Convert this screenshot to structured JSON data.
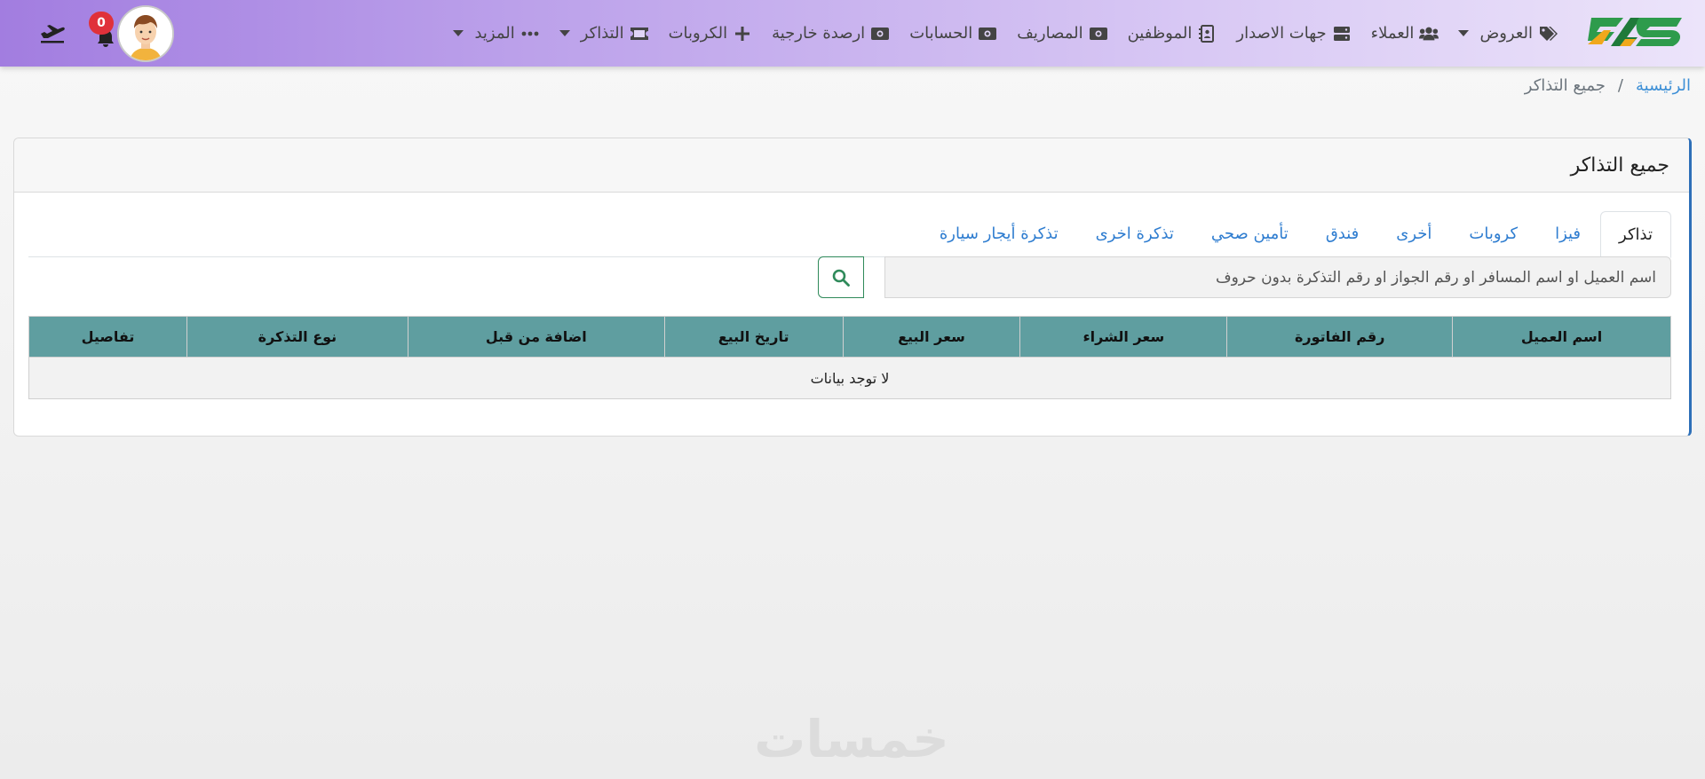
{
  "navbar": {
    "items": [
      {
        "label": "العروض",
        "icon": "tags-icon",
        "dropdown": true
      },
      {
        "label": "العملاء",
        "icon": "users-icon",
        "dropdown": false
      },
      {
        "label": "جهات الاصدار",
        "icon": "server-icon",
        "dropdown": false
      },
      {
        "label": "الموظفين",
        "icon": "address-book-icon",
        "dropdown": false
      },
      {
        "label": "المصاريف",
        "icon": "money-bill-icon",
        "dropdown": false
      },
      {
        "label": "الحسابات",
        "icon": "money-bill-icon",
        "dropdown": false
      },
      {
        "label": "ارصدة خارجية",
        "icon": "money-bill-icon",
        "dropdown": false
      },
      {
        "label": "الكروبات",
        "icon": "plus-icon",
        "dropdown": false
      },
      {
        "label": "التذاكر",
        "icon": "ticket-icon",
        "dropdown": true
      },
      {
        "label": "المزيد",
        "icon": "ellipsis-icon",
        "dropdown": true
      }
    ],
    "notification_count": "0"
  },
  "breadcrumb": {
    "home": "الرئيسية",
    "separator": "/",
    "current": "جميع التذاكر"
  },
  "card": {
    "title": "جميع التذاكر",
    "tabs": [
      {
        "label": "تذاكر",
        "active": true
      },
      {
        "label": "فيزا",
        "active": false
      },
      {
        "label": "كروبات",
        "active": false
      },
      {
        "label": "أخرى",
        "active": false
      },
      {
        "label": "فندق",
        "active": false
      },
      {
        "label": "تأمين صحي",
        "active": false
      },
      {
        "label": "تذكرة اخرى",
        "active": false
      },
      {
        "label": "تذكرة أيجار سيارة",
        "active": false
      }
    ],
    "search": {
      "placeholder": "اسم العميل او اسم المسافر او رقم الجواز او رقم التذكرة بدون حروف"
    },
    "table": {
      "columns": [
        "اسم العميل",
        "رقم الفاتورة",
        "سعر الشراء",
        "سعر البيع",
        "تاريخ البيع",
        "اضافة من قبل",
        "نوع التذكرة",
        "تفاصيل"
      ],
      "empty_message": "لا توجد بيانات"
    }
  },
  "watermark": "خمسات",
  "colors": {
    "nav_start": "#a27de0",
    "nav_end": "#ece4fa",
    "link": "#2f7dd0",
    "table_header": "#5f9ea0",
    "badge": "#e0313a",
    "search_border": "#2f8a5a"
  }
}
